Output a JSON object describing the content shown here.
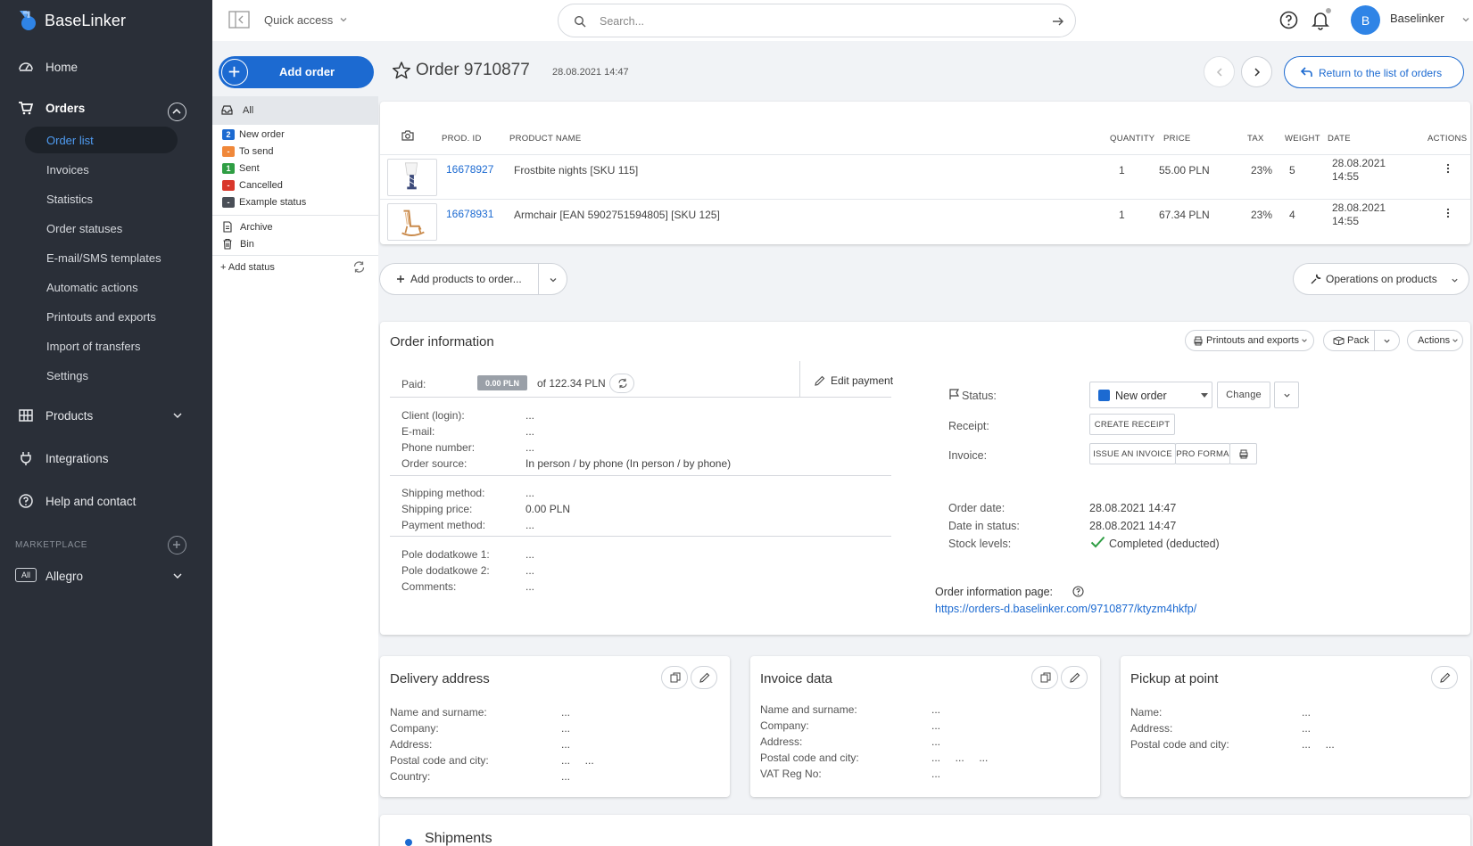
{
  "app": {
    "name": "BaseLinker"
  },
  "sidebar": {
    "home": "Home",
    "orders": "Orders",
    "order_subitems": [
      "Order list",
      "Invoices",
      "Statistics",
      "Order statuses",
      "E-mail/SMS templates",
      "Automatic actions",
      "Printouts and exports",
      "Import of transfers",
      "Settings"
    ],
    "products": "Products",
    "integrations": "Integrations",
    "help": "Help and contact",
    "marketplace_heading": "MARKETPLACE",
    "allegro_badge": "All",
    "allegro": "Allegro"
  },
  "topbar": {
    "quick_access": "Quick access",
    "search_placeholder": "Search...",
    "avatar_initial": "B",
    "user_name": "Baselinker"
  },
  "status_panel": {
    "add_order": "Add order",
    "all": "All",
    "statuses": [
      {
        "badge": "2",
        "label": "New order",
        "color": "#1c6ad1"
      },
      {
        "badge": "-",
        "label": "To send",
        "color": "#f0883a"
      },
      {
        "badge": "1",
        "label": "Sent",
        "color": "#2f9e44"
      },
      {
        "badge": "-",
        "label": "Cancelled",
        "color": "#d9372b"
      },
      {
        "badge": "-",
        "label": "Example status",
        "color": "#4a4f57"
      }
    ],
    "archive": "Archive",
    "bin": "Bin",
    "add_status": "+ Add status"
  },
  "order": {
    "title": "Order 9710877",
    "date": "28.08.2021 14:47",
    "return_label": "Return to the list of orders"
  },
  "products_table": {
    "headers": {
      "prod_id": "PROD. ID",
      "product_name": "PRODUCT NAME",
      "quantity": "QUANTITY",
      "price": "PRICE",
      "tax": "TAX",
      "weight": "WEIGHT",
      "date": "DATE",
      "actions": "ACTIONS"
    },
    "rows": [
      {
        "id": "16678927",
        "name": "Frostbite nights [SKU 115]",
        "quantity": "1",
        "price": "55.00 PLN",
        "tax": "23%",
        "weight": "5",
        "date_line1": "28.08.2021",
        "date_line2": "14:55"
      },
      {
        "id": "16678931",
        "name": "Armchair [EAN 5902751594805] [SKU 125]",
        "quantity": "1",
        "price": "67.34 PLN",
        "tax": "23%",
        "weight": "4",
        "date_line1": "28.08.2021",
        "date_line2": "14:55"
      }
    ],
    "add_products": "Add products to order...",
    "operations": "Operations on products"
  },
  "order_info": {
    "title": "Order information",
    "printouts": "Printouts and exports",
    "pack": "Pack",
    "actions": "Actions",
    "paid_label": "Paid:",
    "paid_amount": "0.00 PLN",
    "paid_of": "of 122.34 PLN",
    "edit_payment": "Edit payment",
    "fields_a": [
      {
        "k": "Client (login):",
        "v": "..."
      },
      {
        "k": "E-mail:",
        "v": "..."
      },
      {
        "k": "Phone number:",
        "v": "..."
      },
      {
        "k": "Order source:",
        "v": "In person / by phone (In person / by phone)"
      }
    ],
    "fields_b": [
      {
        "k": "Shipping method:",
        "v": "..."
      },
      {
        "k": "Shipping price:",
        "v": "0.00 PLN"
      },
      {
        "k": "Payment method:",
        "v": "..."
      }
    ],
    "fields_c": [
      {
        "k": "Pole dodatkowe 1:",
        "v": "..."
      },
      {
        "k": "Pole dodatkowe 2:",
        "v": "..."
      },
      {
        "k": "Comments:",
        "v": "..."
      }
    ],
    "status_label": "Status:",
    "status_value": "New order",
    "change": "Change",
    "receipt_label": "Receipt:",
    "create_receipt": "CREATE RECEIPT",
    "invoice_label": "Invoice:",
    "issue_invoice": "ISSUE AN INVOICE",
    "pro_forma": "PRO FORMA",
    "order_date_label": "Order date:",
    "order_date": "28.08.2021 14:47",
    "date_in_status_label": "Date in status:",
    "date_in_status": "28.08.2021 14:47",
    "stock_label": "Stock levels:",
    "stock_value": "Completed (deducted)",
    "info_page_label": "Order information page:",
    "info_page_url": "https://orders-d.baselinker.com/9710877/ktyzm4hkfp/"
  },
  "delivery": {
    "title": "Delivery address",
    "rows": [
      {
        "k": "Name and surname:",
        "v": "..."
      },
      {
        "k": "Company:",
        "v": "..."
      },
      {
        "k": "Address:",
        "v": "..."
      },
      {
        "k": "Postal code and city:",
        "v": "...     ..."
      },
      {
        "k": "Country:",
        "v": "..."
      }
    ]
  },
  "invoice": {
    "title": "Invoice data",
    "rows": [
      {
        "k": "Name and surname:",
        "v": "..."
      },
      {
        "k": "Company:",
        "v": "..."
      },
      {
        "k": "Address:",
        "v": "..."
      },
      {
        "k": "Postal code and city:",
        "v": "...     ...     ..."
      },
      {
        "k": "VAT Reg No:",
        "v": "..."
      }
    ]
  },
  "pickup": {
    "title": "Pickup at point",
    "rows": [
      {
        "k": "Name:",
        "v": "..."
      },
      {
        "k": "Address:",
        "v": "..."
      },
      {
        "k": "Postal code and city:",
        "v": "...     ..."
      }
    ]
  },
  "shipments": {
    "title": "Shipments"
  },
  "colors": {
    "sidebar_bg": "#2a2f38",
    "accent": "#1c6ad1",
    "link": "#1c6ad1"
  }
}
